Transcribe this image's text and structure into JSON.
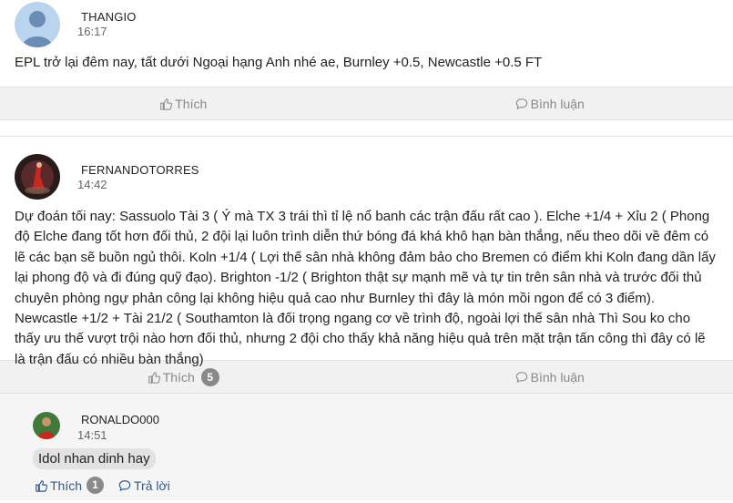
{
  "posts": [
    {
      "username": "THANGIO",
      "time": "16:17",
      "avatar_icon": "default-user-avatar",
      "content": "EPL trở lại đêm nay, tất dưới Ngoại hạng Anh nhé ae, Burnley +0.5, Newcastle +0.5 FT",
      "like_label": "Thích",
      "comment_label": "Bình luận"
    },
    {
      "username": "FERNANDOTORRES",
      "time": "14:42",
      "avatar_icon": "player-photo-avatar",
      "content": "Dự đoán tối nay: Sassuolo Tài 3 ( Ý mà TX 3 trái thì tỉ lệ nổ banh các trận đấu rất cao ). Elche +1/4 + Xỉu 2 ( Phong độ Elche đang tốt hơn đối thủ, 2 đội lại luôn trình diễn thứ bóng đá khá khô hạn bàn thắng, nếu theo dõi về đêm có lẽ các bạn sẽ buồn ngủ thôi. Koln +1/4 ( Lợi thế sân nhà không đảm bảo cho Bremen có điểm khi Koln đang dần lấy lại phong độ và đi đúng quỹ đạo). Brighton -1/2 ( Brighton thật sự mạnh mẽ và tự tin trên sân nhà và trước đối thủ chuyên phòng ngự phản công lại không hiệu quả cao như Burnley thì đây là món mồi ngon để có 3 điểm). Newcastle +1/2 + Tài 21/2 ( Southamton là đối trọng ngang cơ về trình độ, ngoài lợi thế sân nhà Thì Sou ko cho thấy ưu thế vượt trội nào hơn đối thủ, nhưng 2 đội cho thấy khả năng hiệu quả trên mặt trận tấn công thì đây có lẽ là trận đấu có nhiều bàn thắng)",
      "like_label": "Thích",
      "like_count": "5",
      "comment_label": "Bình luận"
    }
  ],
  "reply": {
    "username": "RONALDO000",
    "time": "14:51",
    "avatar_icon": "player-photo-avatar",
    "content": "Idol nhan dinh hay",
    "like_label": "Thích",
    "like_count": "1",
    "reply_label": "Trả lời"
  },
  "colors": {
    "action_bar": "#f1f1f1",
    "action_text": "#888888",
    "badge": "#8a8a8a",
    "reply_link": "#2f5a8a",
    "reply_bg": "#f5f5f5"
  }
}
